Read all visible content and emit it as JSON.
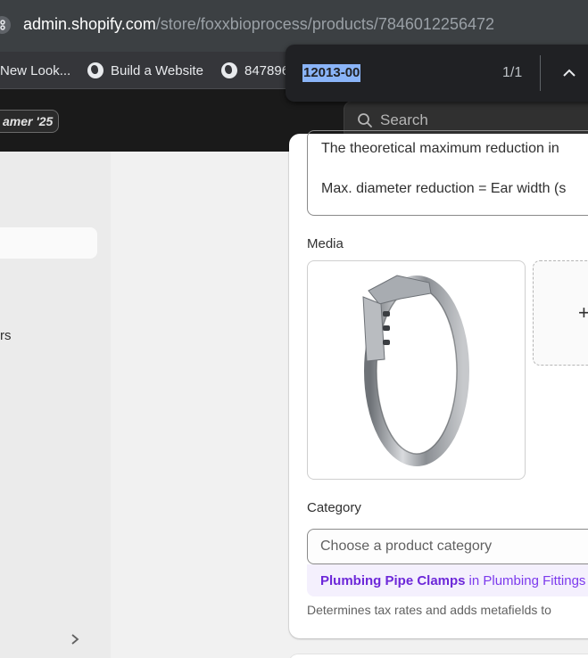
{
  "browser": {
    "url_host": "admin.shopify.com",
    "url_path": "/store/foxxbioprocess/products/7846012256472",
    "bookmarks": [
      {
        "label": "New Look..."
      },
      {
        "label": "Build a Website"
      },
      {
        "label": "847896"
      }
    ]
  },
  "find_bar": {
    "query": "12013-00",
    "count": "1/1"
  },
  "topbar": {
    "badge": "amer '25",
    "search_placeholder": "Search"
  },
  "sidebar": {
    "fragment": "rs"
  },
  "product": {
    "description_line1": "The theoretical maximum reduction in",
    "description_line2": "Max. diameter reduction = Ear width (s",
    "media_label": "Media",
    "add_media_symbol": "+",
    "category_label": "Category",
    "category_placeholder": "Choose a product category",
    "suggestion_bold": "Plumbing Pipe Clamps",
    "suggestion_rest": "in Plumbing Fittings",
    "helper_text": "Determines tax rates and adds metafields to"
  }
}
